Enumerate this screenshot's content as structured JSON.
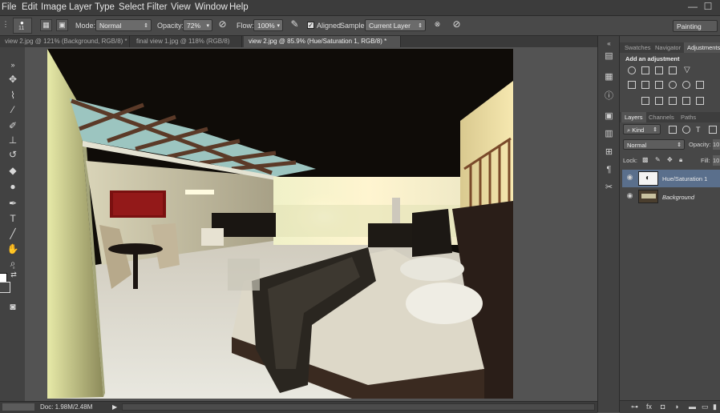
{
  "menubar": {
    "items": [
      "File",
      "Edit",
      "Image",
      "Layer",
      "Type",
      "Select",
      "Filter",
      "View",
      "Window",
      "Help"
    ],
    "window_controls": {
      "minimize": "—",
      "maximize": "☐"
    }
  },
  "options_bar": {
    "brush_size": "11",
    "mode_label": "Mode:",
    "mode_value": "Normal",
    "opacity_label": "Opacity:",
    "opacity_value": "72%",
    "flow_label": "Flow:",
    "flow_value": "100%",
    "aligned_label": "Aligned",
    "sample_label": "Sample:",
    "sample_value": "Current Layer",
    "workspace": "Painting"
  },
  "tabs": [
    {
      "label": "view 2.jpg @ 121% (Background, RGB/8) *",
      "active": false
    },
    {
      "label": "final view 1.jpg @ 118% (RGB/8)",
      "active": false
    },
    {
      "label": "view 2.jpg @ 85.9% (Hue/Saturation 1, RGB/8) *",
      "active": true
    }
  ],
  "status": {
    "doc_info": "Doc: 1.98M/2.48M"
  },
  "panels": {
    "top_tabs": [
      "Swatches",
      "Navigator",
      "Adjustments"
    ],
    "adjustments_title": "Add an adjustment",
    "layer_tabs": [
      "Layers",
      "Channels",
      "Paths"
    ],
    "kind_label": "Kind",
    "blend_mode": "Normal",
    "opacity_label": "Opacity:",
    "opacity_value": "10",
    "lock_label": "Lock:",
    "fill_label": "Fill:",
    "fill_value": "10",
    "layers": [
      {
        "name": "Hue/Saturation 1",
        "selected": true
      },
      {
        "name": "Background",
        "selected": false
      }
    ]
  },
  "colors": {
    "accent_selected_layer": "#5a6f8c",
    "workspace_bg": "#535353"
  }
}
